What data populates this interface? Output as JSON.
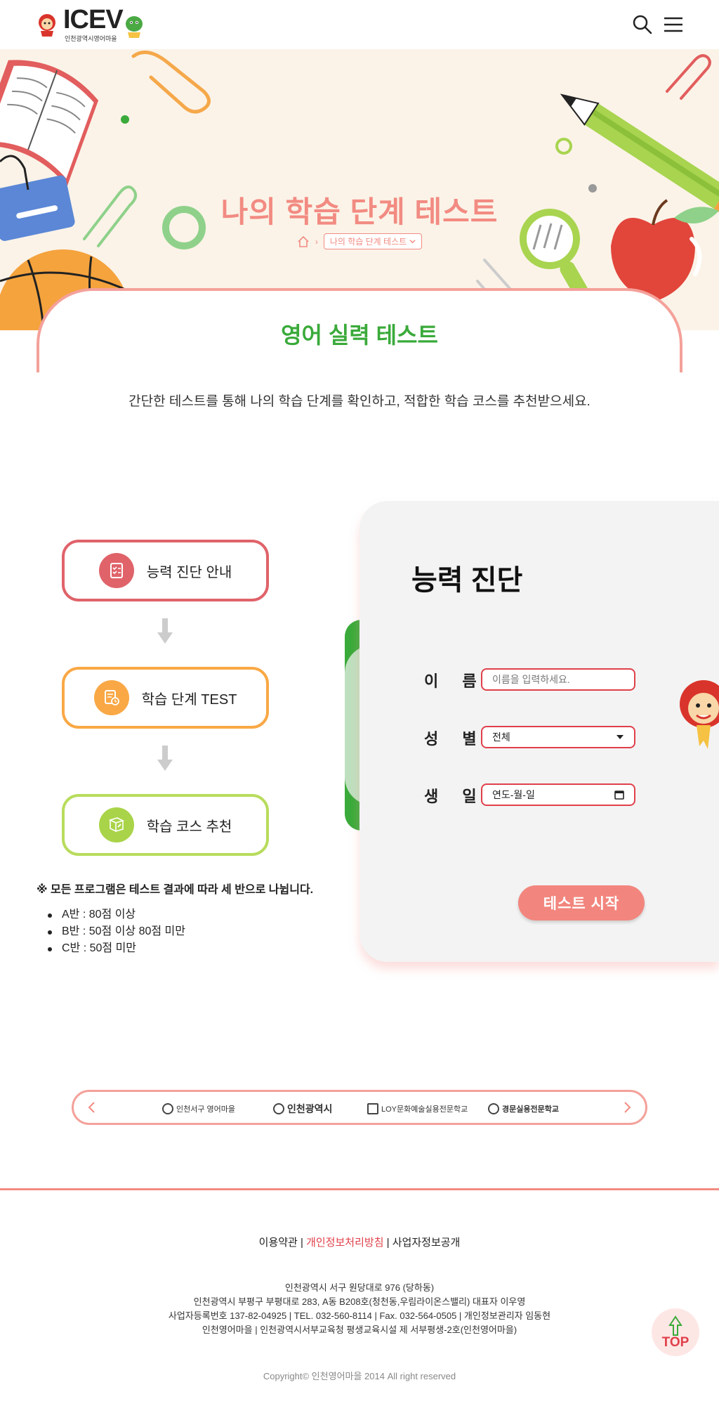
{
  "header": {
    "brand": "ICEV",
    "brand_sub": "인천광역시영어마을",
    "search_icon": "search-icon",
    "menu_icon": "hamburger-menu-icon"
  },
  "hero": {
    "title": "나의 학습 단계 테스트",
    "breadcrumb_current": "나의 학습 단계 테스트",
    "bg_color": "#fbf3e8",
    "title_color": "#f28b82"
  },
  "tab": {
    "title": "영어 실력 테스트"
  },
  "intro": "간단한 테스트를 통해 나의 학습 단계를 확인하고, 적합한 학습 코스를 추천받으세요.",
  "steps": [
    {
      "label": "능력 진단 안내",
      "icon": "checklist-icon",
      "color": "#e0636a"
    },
    {
      "label": "학습 단계 TEST",
      "icon": "test-clock-icon",
      "color": "#f9a845"
    },
    {
      "label": "학습 코스 추천",
      "icon": "recommend-book-icon",
      "color": "#a9d449"
    }
  ],
  "note": "※ 모든 프로그램은 테스트 결과에 따라 세 반으로 나뉩니다.",
  "classes": [
    "A반 : 80점 이상",
    "B반 : 50점 이상 80점 미만",
    "C반 : 50점 미만"
  ],
  "form": {
    "title": "능력 진단",
    "name_label": "이 름",
    "name_placeholder": "이름을 입력하세요.",
    "gender_label": "성 별",
    "gender_value": "전체",
    "birth_label": "생 일",
    "birth_value": "연도-월-일",
    "start_button": "테스트 시작"
  },
  "partners": [
    "인천서구 영어마을",
    "인천광역시",
    "LOY문화예술실용전문학교",
    "경문실용전문학교"
  ],
  "footer": {
    "link_terms": "이용약관",
    "link_privacy": "개인정보처리방침",
    "link_business": "사업자정보공개",
    "info_lines": [
      "인천광역시 서구 원당대로 976 (당하동)",
      "인천광역시 부평구 부평대로 283, A동 B208호(청천동,우림라이온스밸리) 대표자 이우영",
      "사업자등록번호 137-82-04925 | TEL. 032-560-8114 | Fax. 032-564-0505 | 개인정보관리자 임동현",
      "인천영어마을 | 인천광역시서부교육청 평생교육시설 제 서부평생-2호(인천영어마을)"
    ],
    "copyright": "Copyright© 인천영어마을 2014 All right reserved",
    "top_button": "TOP"
  },
  "colors": {
    "accent_pink": "#f28b82",
    "accent_green": "#3aaa3a",
    "input_border": "#e0404a"
  }
}
